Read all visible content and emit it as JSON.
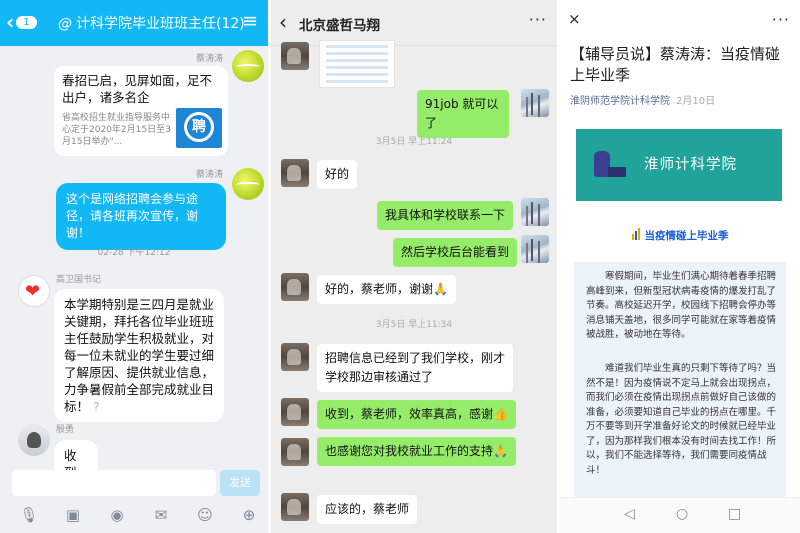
{
  "panel1": {
    "badge": "1",
    "at_symbol": "@",
    "title": "计科学院毕业班班主任(12)",
    "menu_icon": "≡",
    "messages": {
      "card_sender": "蔡涛涛",
      "card_title": "春招已启，见屏如面，足不出户，诸多名企",
      "card_desc": "省高校招生就业指导服务中心定于2020年2月15日至3月15日举办\"...",
      "card_logo_text": "聘",
      "blue_sender": "蔡涛涛",
      "blue_text": "这个是网络招聘会参与途径，请各班再次宣传，谢谢！",
      "timestamp": "02-28 下午12:12",
      "long_sender": "高卫国书记",
      "long_text": "本学期特别是三四月是就业关键期，拜托各位毕业班班主任鼓励学生积极就业，对每一位未就业的学生要过细了解原因、提供就业信息，力争暑假前全部完成就业目标！",
      "long_tail": "?",
      "reply_sender": "殷勇",
      "reply_text": "收到"
    },
    "send_label": "发送",
    "tool_icons": [
      "microphone-icon",
      "image-icon",
      "camera-icon",
      "redpacket-icon",
      "emoji-icon",
      "plus-icon"
    ]
  },
  "panel2": {
    "back_icon": "‹",
    "title": "北京盛哲马翔",
    "more_icon": "···",
    "messages": [
      {
        "side": "right",
        "text": "91job 就可以了"
      },
      {
        "side": "time",
        "text": "3月5日 早上11:24"
      },
      {
        "side": "left",
        "text": "好的"
      },
      {
        "side": "right",
        "text": "我具体和学校联系一下"
      },
      {
        "side": "right",
        "text": "然后学校后台能看到"
      },
      {
        "side": "left",
        "text": "好的，蔡老师，谢谢🙏"
      },
      {
        "side": "time",
        "text": "3月5日 早上11:34"
      },
      {
        "side": "left",
        "text": "招聘信息已经到了我们学校，刚才学校那边审核通过了"
      },
      {
        "side": "right",
        "text": "收到，蔡老师，效率真高，感谢👍"
      },
      {
        "side": "left",
        "text": "也感谢您对我校就业工作的支持🙏"
      },
      {
        "side": "left",
        "text": "应该的，蔡老师"
      }
    ]
  },
  "panel3": {
    "close_icon": "×",
    "more_icon": "···",
    "title": "【辅导员说】蔡涛涛：当疫情碰上毕业季",
    "source": "淮阴师范学院计科学院",
    "date": "2月10日",
    "banner_name": "淮师计科学院",
    "subtitle": "当疫情碰上毕业季",
    "para1": "寒假期间，毕业生们满心期待着春季招聘高峰到来，但新型冠状病毒疫情的爆发打乱了节奏。高校延迟开学，校园线下招聘会停办等消息铺天盖地，很多同学可能就在家等着疫情被战胜，被动地在等待。",
    "para2": "难道我们毕业生真的只剩下等待了吗？当然不是！因为疫情说不定马上就会出现拐点，而我们必须在疫情出现拐点前做好自己该做的准备，必须要知道自己毕业的拐点在哪里。千万不要等到开学准备好论文的时候就已经毕业了，因为那样我们根本没有时间去找工作！所以，我们不能选择等待，我们需要同疫情战斗！",
    "nav": [
      "◁",
      "○",
      "□"
    ]
  },
  "colors": {
    "qq_blue": "#12b7f5",
    "wx_green": "#95ec69",
    "banner_teal": "#1fa39a",
    "link_blue": "#576b95"
  }
}
